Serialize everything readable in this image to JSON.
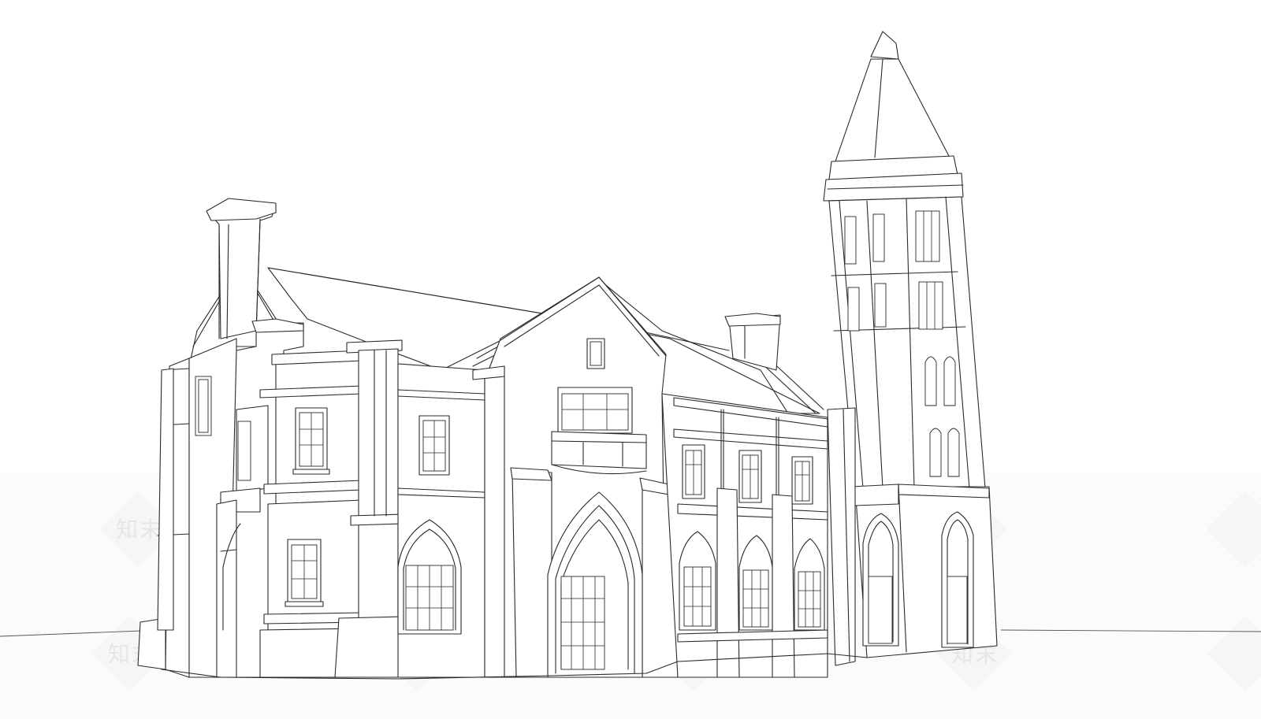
{
  "watermark": {
    "text": "知末",
    "color": "#e6e6e6"
  },
  "drawing": {
    "subject": "church-line-drawing",
    "line_color": "#2a2a2a",
    "background": "#ffffff"
  }
}
